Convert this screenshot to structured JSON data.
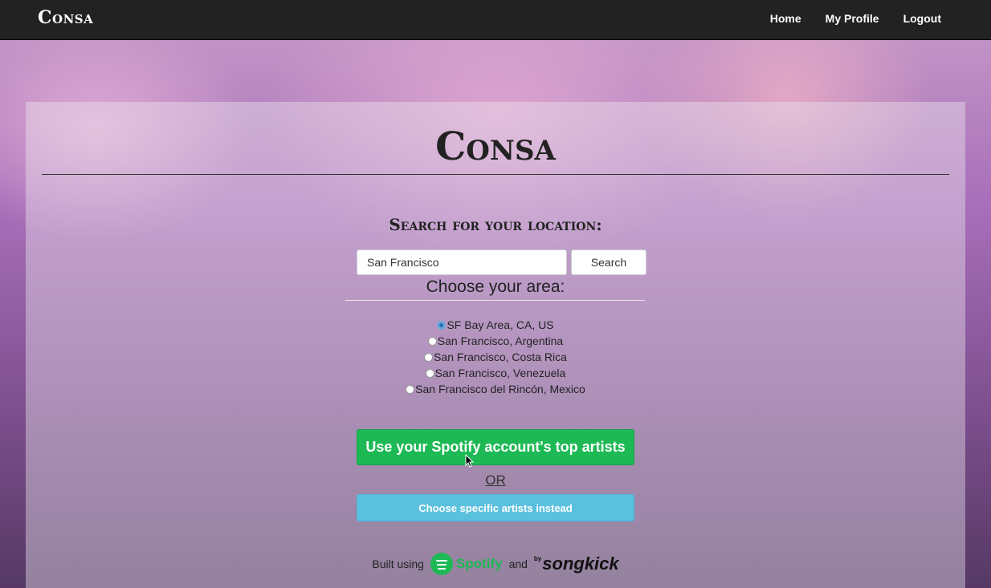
{
  "navbar": {
    "brand": "Consa",
    "links": [
      "Home",
      "My Profile",
      "Logout"
    ]
  },
  "panel": {
    "title": "Consa",
    "search_heading": "Search for your location:",
    "search_value": "San Francisco",
    "search_button": "Search",
    "area_heading": "Choose your area:",
    "areas": [
      {
        "label": "SF Bay Area, CA, US",
        "checked": true
      },
      {
        "label": "San Francisco, Argentina",
        "checked": false
      },
      {
        "label": "San Francisco, Costa Rica",
        "checked": false
      },
      {
        "label": "San Francisco, Venezuela",
        "checked": false
      },
      {
        "label": "San Francisco del Rincón, Mexico",
        "checked": false
      }
    ],
    "spotify_button": "Use your Spotify account's top artists",
    "or_text": "OR",
    "artists_button": "Choose specific artists instead",
    "footer": {
      "built_using": "Built using",
      "spotify": "Spotify",
      "and": "and",
      "songkick_by": "by",
      "songkick": "songkick"
    }
  },
  "colors": {
    "navbar": "#222222",
    "spotify_green": "#1db954",
    "info_blue": "#5bc0de"
  }
}
